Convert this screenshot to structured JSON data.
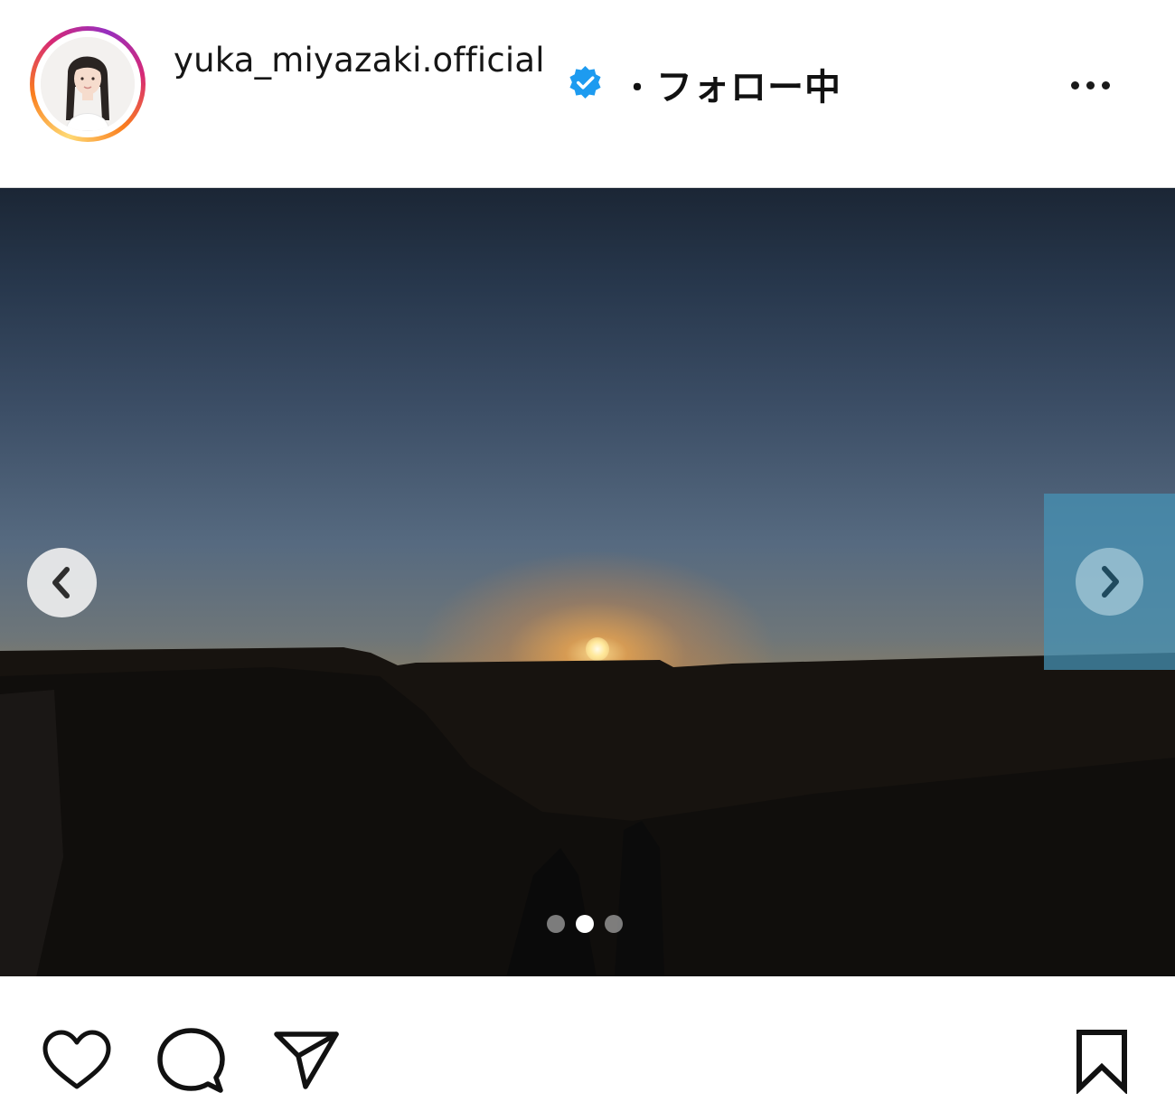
{
  "post": {
    "username": "yuka_miyazaki.official",
    "verified_icon": "verified-badge-icon",
    "separator": "・",
    "follow_status": "フォロー中",
    "more_icon": "more-options-icon"
  },
  "carousel": {
    "slide_count": 3,
    "active_index": 1,
    "prev_icon": "chevron-left-icon",
    "next_icon": "chevron-right-icon"
  },
  "actions": {
    "like_icon": "heart-icon",
    "comment_icon": "comment-icon",
    "share_icon": "share-icon",
    "save_icon": "bookmark-icon"
  },
  "colors": {
    "verified": "#1D9BF0",
    "text": "#111111",
    "ring_start": "#feda75",
    "ring_end": "#962fbf"
  }
}
